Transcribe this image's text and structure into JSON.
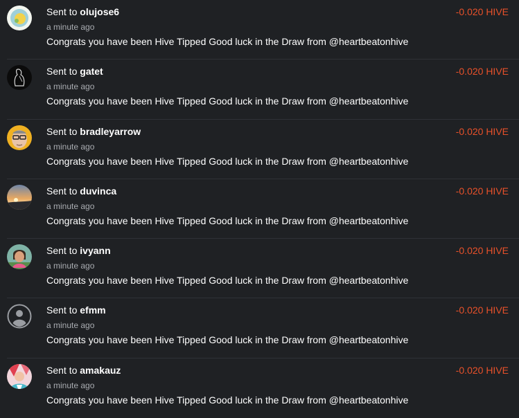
{
  "transfers": [
    {
      "prefix": "Sent to",
      "user": "olujose6",
      "time": "a minute ago",
      "memo": "Congrats you have been Hive Tipped Good luck in the Draw from @heartbeatonhive",
      "amount": "-0.020 HIVE",
      "avatar": "sun-avatar"
    },
    {
      "prefix": "Sent to",
      "user": "gatet",
      "time": "a minute ago",
      "memo": "Congrats you have been Hive Tipped Good luck in the Draw from @heartbeatonhive",
      "amount": "-0.020 HIVE",
      "avatar": "dark-figure-avatar"
    },
    {
      "prefix": "Sent to",
      "user": "bradleyarrow",
      "time": "a minute ago",
      "memo": "Congrats you have been Hive Tipped Good luck in the Draw from @heartbeatonhive",
      "amount": "-0.020 HIVE",
      "avatar": "person-glasses-avatar"
    },
    {
      "prefix": "Sent to",
      "user": "duvinca",
      "time": "a minute ago",
      "memo": "Congrats you have been Hive Tipped Good luck in the Draw from @heartbeatonhive",
      "amount": "-0.020 HIVE",
      "avatar": "sunset-avatar"
    },
    {
      "prefix": "Sent to",
      "user": "ivyann",
      "time": "a minute ago",
      "memo": "Congrats you have been Hive Tipped Good luck in the Draw from @heartbeatonhive",
      "amount": "-0.020 HIVE",
      "avatar": "woman-avatar"
    },
    {
      "prefix": "Sent to",
      "user": "efmm",
      "time": "a minute ago",
      "memo": "Congrats you have been Hive Tipped Good luck in the Draw from @heartbeatonhive",
      "amount": "-0.020 HIVE",
      "avatar": "default-user-avatar"
    },
    {
      "prefix": "Sent to",
      "user": "amakauz",
      "time": "a minute ago",
      "memo": "Congrats you have been Hive Tipped Good luck in the Draw from @heartbeatonhive",
      "amount": "-0.020 HIVE",
      "avatar": "colorful-avatar"
    }
  ],
  "colors": {
    "background": "#1f2124",
    "amount": "#e8512a",
    "divider": "#2f3237",
    "muted_text": "#a9acb1"
  }
}
